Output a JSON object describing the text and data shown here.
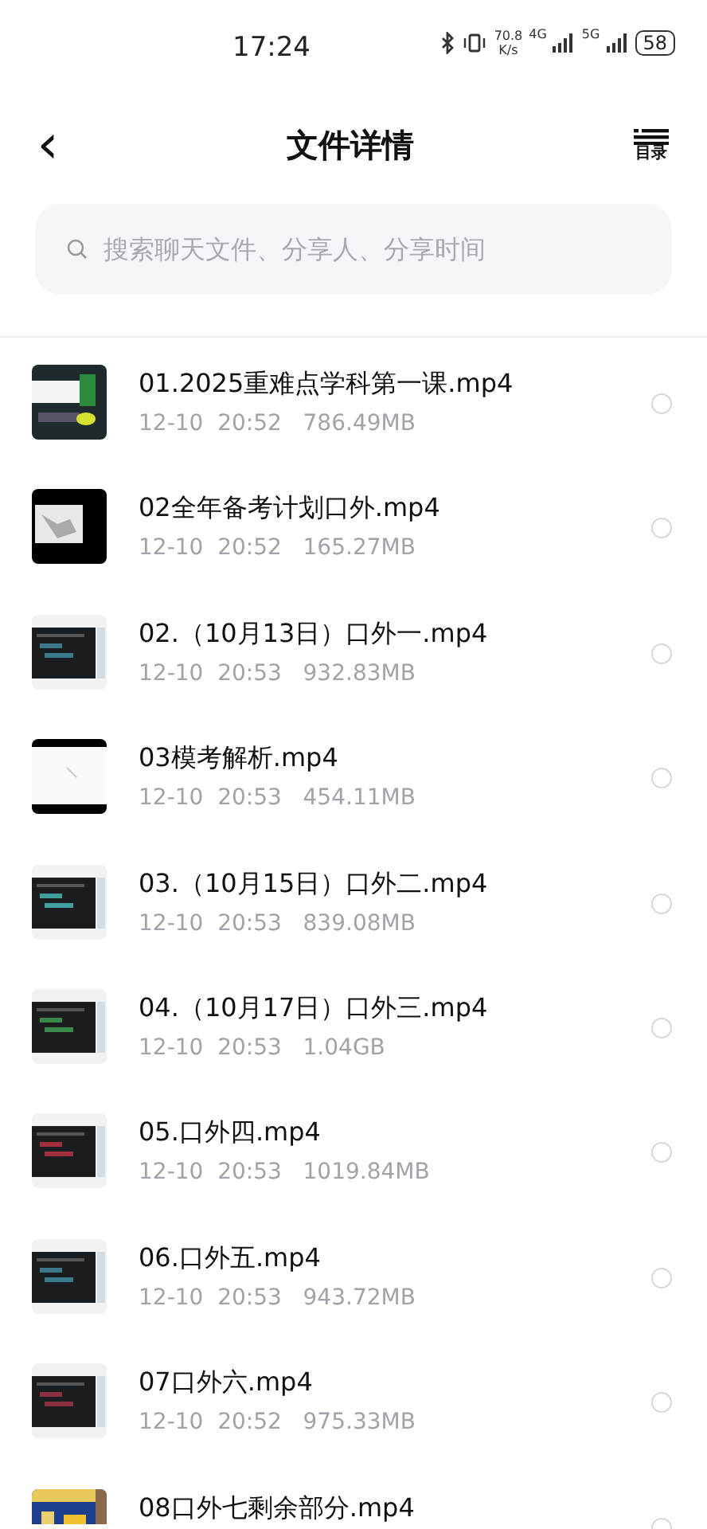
{
  "status_bar": {
    "time": "17:24",
    "net_speed": "70.8",
    "net_unit": "K/s",
    "network_1": "4G",
    "network_2": "5G",
    "battery": "58"
  },
  "header": {
    "back": "‹",
    "title": "文件详情",
    "menu_label": "目录"
  },
  "search": {
    "placeholder": "搜索聊天文件、分享人、分享时间"
  },
  "files": [
    {
      "name": "01.2025重难点学科第一课.mp4",
      "date": "12-10",
      "time": "20:52",
      "size": "786.49MB",
      "selected": false
    },
    {
      "name": "02全年备考计划口外.mp4",
      "date": "12-10",
      "time": "20:52",
      "size": "165.27MB",
      "selected": false
    },
    {
      "name": "02.（10月13日）口外一.mp4",
      "date": "12-10",
      "time": "20:53",
      "size": "932.83MB",
      "selected": false
    },
    {
      "name": "03模考解析.mp4",
      "date": "12-10",
      "time": "20:53",
      "size": "454.11MB",
      "selected": false
    },
    {
      "name": "03.（10月15日）口外二.mp4",
      "date": "12-10",
      "time": "20:53",
      "size": "839.08MB",
      "selected": false
    },
    {
      "name": "04.（10月17日）口外三.mp4",
      "date": "12-10",
      "time": "20:53",
      "size": "1.04GB",
      "selected": false
    },
    {
      "name": "05.口外四.mp4",
      "date": "12-10",
      "time": "20:53",
      "size": "1019.84MB",
      "selected": false
    },
    {
      "name": "06.口外五.mp4",
      "date": "12-10",
      "time": "20:53",
      "size": "943.72MB",
      "selected": false
    },
    {
      "name": "07口外六.mp4",
      "date": "12-10",
      "time": "20:52",
      "size": "975.33MB",
      "selected": false
    },
    {
      "name": "08口外七剩余部分.mp4",
      "selected": false
    }
  ]
}
